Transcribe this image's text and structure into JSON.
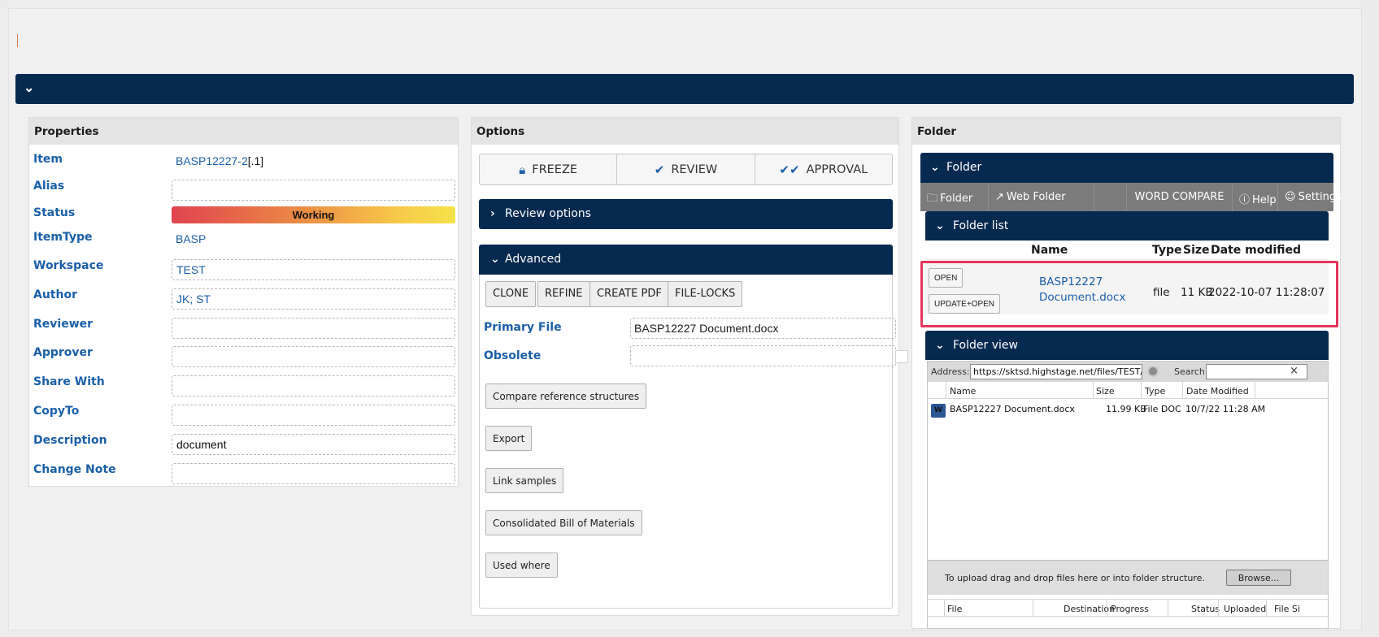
{
  "properties": {
    "title": "Properties",
    "rows": [
      {
        "label": "Item",
        "value": "BASP12227-2",
        "suffix": "[.1]"
      },
      {
        "label": "Alias",
        "value": ""
      },
      {
        "label": "Status",
        "value": "Working"
      },
      {
        "label": "ItemType",
        "value": "BASP"
      },
      {
        "label": "Workspace",
        "value": "TEST"
      },
      {
        "label": "Author",
        "value": "JK; ST"
      },
      {
        "label": "Reviewer",
        "value": ""
      },
      {
        "label": "Approver",
        "value": ""
      },
      {
        "label": "Share With",
        "value": ""
      },
      {
        "label": "CopyTo",
        "value": ""
      },
      {
        "label": "Description",
        "value": "document"
      },
      {
        "label": "Change Note",
        "value": ""
      }
    ]
  },
  "options": {
    "title": "Options",
    "tabs": [
      {
        "label": "FREEZE",
        "icon": "lock-icon"
      },
      {
        "label": "REVIEW",
        "icon": "check-icon"
      },
      {
        "label": "APPROVAL",
        "icon": "double-check-icon"
      }
    ],
    "review_options": "Review options",
    "advanced": "Advanced",
    "actions": [
      "CLONE",
      "REFINE",
      "CREATE PDF",
      "FILE-LOCKS"
    ],
    "primary_file_label": "Primary File",
    "primary_file_value": "BASP12227 Document.docx",
    "obsolete_label": "Obsolete",
    "buttons": [
      "Compare reference structures",
      "Export",
      "Link samples",
      "Consolidated Bill of Materials",
      "Used where"
    ]
  },
  "folder": {
    "title": "Folder",
    "header": "Folder",
    "toolbar": [
      {
        "label": "Folder",
        "icon": "folder-icon"
      },
      {
        "label": "Web Folder",
        "icon": "web-folder-icon"
      },
      {
        "label": "WORD COMPARE",
        "icon": ""
      },
      {
        "label": "Help",
        "icon": "help-icon"
      },
      {
        "label": "Settings",
        "icon": "user-settings-icon"
      }
    ],
    "folder_list": {
      "title": "Folder list",
      "columns": [
        "Name",
        "Type",
        "Size",
        "Date modified"
      ],
      "row": {
        "open": "OPEN",
        "update_open": "UPDATE+OPEN",
        "name": "BASP12227 Document.docx",
        "type": "file",
        "size": "11 KB",
        "date": "2022-10-07 11:28:07"
      }
    },
    "folder_view": {
      "title": "Folder view",
      "address_label": "Address:",
      "address_value": "https://sktsd.highstage.net/files/TEST/BAS",
      "search_label": "Search:",
      "search_value": "",
      "close": "×",
      "columns": [
        "Name",
        "Size",
        "Type",
        "Date Modified"
      ],
      "file": {
        "name": "BASP12227 Document.docx",
        "size": "11.99 KB",
        "type": "File DOC>",
        "date": "10/7/22 11:28 AM"
      },
      "upload_text": "To upload drag and drop files here or into folder structure.",
      "browse": "Browse...",
      "upload_columns": [
        "File",
        "Destination",
        "Progress",
        "Status",
        "Uploaded",
        "File Si"
      ]
    }
  },
  "colors": {
    "navy": "#06294f",
    "link": "#1a5fa8",
    "highlight": "#e6355d"
  }
}
